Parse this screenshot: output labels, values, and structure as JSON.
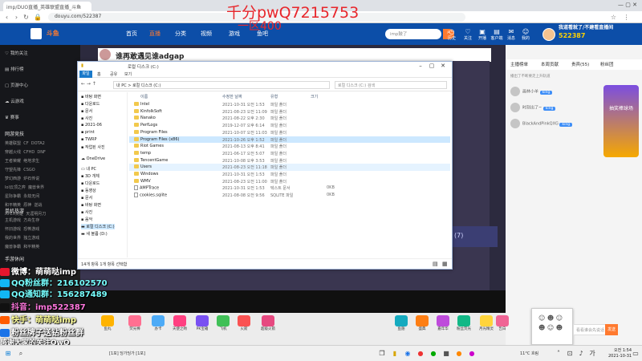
{
  "browser": {
    "tab_title": "imp/DUO直播_英雄联盟直播_斗鱼",
    "url": "douyu.com/522387"
  },
  "overlay": {
    "top_red": "千分pwQ7215753",
    "sub_red": "一区400",
    "lines": [
      "微博：萌萌哒imp",
      "QQ粉丝群：216102570",
      "QQ通知群：156287489",
      "抖音：imp522387",
      "快手：萌萌哒imp",
      "粉丝牌子送钻粉丝群",
      "感谢大家的关注OwO"
    ]
  },
  "site": {
    "logo": "斗鱼",
    "nav": [
      "首页",
      "直播",
      "分类",
      "视频",
      "游戏",
      "鱼吧"
    ],
    "search_placeholder": "imp鼓了",
    "header_icons": [
      "历史",
      "关注",
      "开播",
      "客户端",
      "消息",
      "我的",
      "鱼吧"
    ],
    "promo_text": "我道看就了/不建看直播间",
    "room_number": "522387"
  },
  "sidebar": {
    "items": [
      "我的关注",
      "排行榜",
      "页游中心",
      "云游戏",
      "赛事"
    ],
    "section1": "网游竞技",
    "grid1": [
      "英雄联盟",
      "CF",
      "DOTA2",
      "穿越火线",
      "CFHD",
      "DNF",
      "王者荣耀",
      "绝地求生",
      "守望先锋",
      "CSGO",
      "梦幻西游",
      "炉石传说",
      "lol云顶之弈",
      "魔兽世界",
      "星际争霸",
      "永劫无间",
      "和平精英",
      "原神",
      "逆战",
      "APEX英雄",
      "天涯明月刀"
    ],
    "section2": "单机热游",
    "grid2": [
      "主机游戏",
      "方舟生存",
      "怀旧游戏",
      "恐怖游戏",
      "我的世界",
      "独立游戏",
      "魔兽争霸",
      "和平精英"
    ],
    "section3": "手游休闲"
  },
  "stream": {
    "title": "谁再敢遇见谁adgap",
    "video_badge": "(7)"
  },
  "explorer": {
    "title": "로컬 디스크 (C:)",
    "ribbon_tabs": [
      "파일",
      "홈",
      "공유",
      "보기"
    ],
    "address": "내 PC > 로컬 디스크 (C:)",
    "search_placeholder": "로컬 디스크 (C:) 검색",
    "col_headers": [
      "이름",
      "수정한 날짜",
      "유형",
      "크기"
    ],
    "tree": [
      "바탕 화면",
      "다운로드",
      "문서",
      "사진",
      "2021-06",
      "print",
      "TWRP",
      "작업된 사진",
      "OneDrive",
      "내 PC",
      "3D 개체",
      "다운로드",
      "동영상",
      "문서",
      "바탕 화면",
      "사진",
      "음악",
      "로컬 디스크 (C:)",
      "새 볼륨 (D:)"
    ],
    "files": [
      {
        "name": "Intel",
        "date": "2021-10-31 오전 1:53",
        "type": "파일 폴더",
        "size": "",
        "kind": "folder"
      },
      {
        "name": "KinfolkSoft",
        "date": "2021-08-23 오전 11:09",
        "type": "파일 폴더",
        "size": "",
        "kind": "folder"
      },
      {
        "name": "Nanako",
        "date": "2021-08-22 오후 2:30",
        "type": "파일 폴더",
        "size": "",
        "kind": "folder"
      },
      {
        "name": "PerfLogs",
        "date": "2019-12-07 오후 6:14",
        "type": "파일 폴더",
        "size": "",
        "kind": "folder"
      },
      {
        "name": "Program Files",
        "date": "2021-10-07 오전 11:03",
        "type": "파일 폴더",
        "size": "",
        "kind": "folder"
      },
      {
        "name": "Program Files (x86)",
        "date": "2021-10-26 오후 1:52",
        "type": "파일 폴더",
        "size": "",
        "kind": "folder"
      },
      {
        "name": "Riot Games",
        "date": "2021-08-13 오후 8:41",
        "type": "파일 폴더",
        "size": "",
        "kind": "folder"
      },
      {
        "name": "temp",
        "date": "2021-06-17 오전 5:07",
        "type": "파일 폴더",
        "size": "",
        "kind": "folder"
      },
      {
        "name": "TencentGame",
        "date": "2021-10-08 오후 3:53",
        "type": "파일 폴더",
        "size": "",
        "kind": "folder"
      },
      {
        "name": "Users",
        "date": "2021-08-23 오전 11:18",
        "type": "파일 폴더",
        "size": "",
        "kind": "folder"
      },
      {
        "name": "Windows",
        "date": "2021-10-31 오전 1:53",
        "type": "파일 폴더",
        "size": "",
        "kind": "folder"
      },
      {
        "name": "WMV",
        "date": "2021-08-23 오전 11:00",
        "type": "파일 폴더",
        "size": "",
        "kind": "folder"
      },
      {
        "name": "AMPTrace",
        "date": "2021-10-31 오전 1:53",
        "type": "텍스트 문서",
        "size": "0KB",
        "kind": "file"
      },
      {
        "name": "cookies.sqlite",
        "date": "2021-08-08 오전 9:56",
        "type": "SQLITE 파일",
        "size": "0KB",
        "kind": "file"
      }
    ],
    "status": "14개 항목   1개 항목 선택함"
  },
  "rpanel": {
    "tabs": [
      "主播榜单",
      "本周贡献",
      "贵宾(55)",
      "粉丝团"
    ],
    "notice": "播出了不断要走上升轨道",
    "users": [
      {
        "name": "画林小羊",
        "badge": "king"
      },
      {
        "name": "时刻出了~",
        "badge": "king"
      },
      {
        "name": "BlackAndPinkQXG",
        "badge": "king"
      }
    ],
    "chat_placeholder": "看看谁会先说话",
    "send": "发送",
    "promo": "抽奖棒球场"
  },
  "gifts": [
    "鱼丸",
    "荧光棒",
    "办卡",
    "天使之吻",
    "PK宝箱",
    "飞机",
    "火箭",
    "超级火箭",
    "鱼翅",
    "盛典",
    "嘉年华",
    "粉丝荧光",
    "月光精灵",
    "告白"
  ],
  "taskbar": {
    "time": "오전 1:54",
    "date": "2021-10-31",
    "weather": "11°C 흐림",
    "app_label": "[1포] 딩가딩가 [1포]"
  }
}
